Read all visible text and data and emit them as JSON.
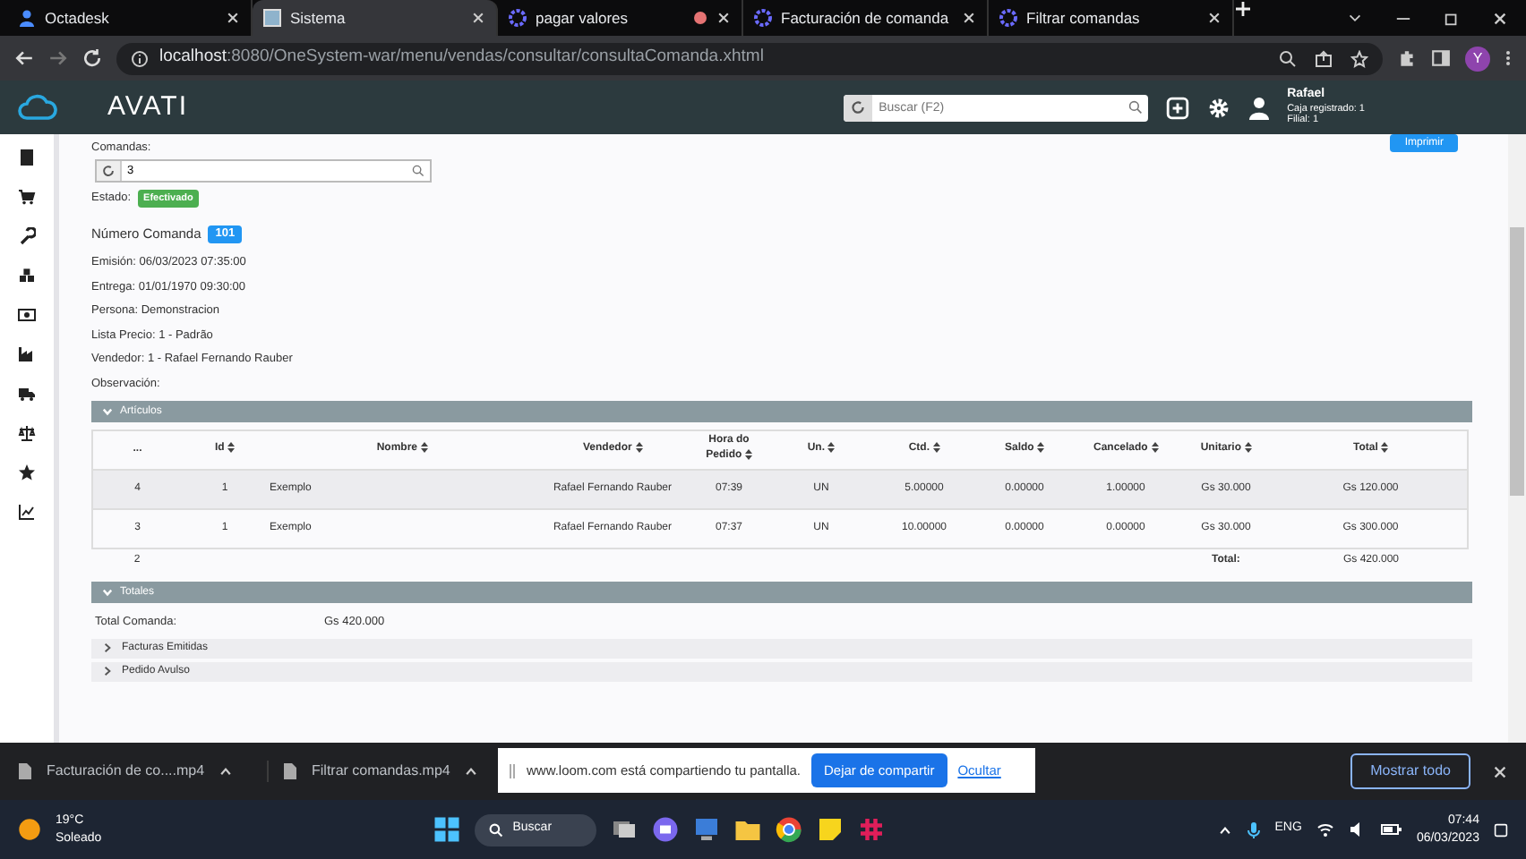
{
  "browser": {
    "tabs": [
      {
        "title": "Octadesk",
        "selected": false
      },
      {
        "title": "Sistema",
        "selected": true
      },
      {
        "title": "pagar valores",
        "selected": false,
        "recording": true
      },
      {
        "title": "Facturación de comanda",
        "selected": false
      },
      {
        "title": "Filtrar comandas",
        "selected": false
      }
    ],
    "url_host": "localhost",
    "url_rest": ":8080/OneSystem-war/menu/vendas/consultar/consultaComanda.xhtml",
    "profile": "Y"
  },
  "app": {
    "brand": "AVATI",
    "search_placeholder": "Buscar (F2)",
    "user": "Rafael",
    "user_lines": [
      "Caja registrado: 1",
      "Filial: 1"
    ],
    "print_button": "Imprimir"
  },
  "form": {
    "comandas_label": "Comandas:",
    "comandas_value": "3",
    "estado_label": "Estado:",
    "estado": "Efectivado",
    "numero_label": "Número Comanda",
    "numero": "101",
    "details": [
      "Emisión: 06/03/2023 07:35:00",
      "Entrega: 01/01/1970 09:30:00",
      "Persona: Demonstracion",
      "Lista Precio: 1 - Padrão",
      "Vendedor: 1 - Rafael Fernando Rauber",
      "Observación:"
    ]
  },
  "articulos": {
    "title": "Artículos",
    "expanded": true,
    "columns": [
      {
        "label": "...",
        "sortable": false
      },
      {
        "label": "Id",
        "sortable": true
      },
      {
        "label": "Nombre",
        "sortable": true
      },
      {
        "label": "Vendedor",
        "sortable": true
      },
      {
        "label": "Hora do Pedido",
        "sortable": true
      },
      {
        "label": "Un.",
        "sortable": true
      },
      {
        "label": "Ctd.",
        "sortable": true
      },
      {
        "label": "Saldo",
        "sortable": true
      },
      {
        "label": "Cancelado",
        "sortable": true
      },
      {
        "label": "Unitario",
        "sortable": true
      },
      {
        "label": "Total",
        "sortable": true
      }
    ],
    "rows": [
      {
        "selected": true,
        "cells": [
          "4",
          "1",
          "Exemplo",
          "Rafael Fernando Rauber",
          "07:39",
          "UN",
          "5.00000",
          "0.00000",
          "1.00000",
          "Gs 30.000",
          "Gs 120.000"
        ]
      },
      {
        "selected": false,
        "cells": [
          "3",
          "1",
          "Exemplo",
          "Rafael Fernando Rauber",
          "07:37",
          "UN",
          "10.00000",
          "0.00000",
          "0.00000",
          "Gs 30.000",
          "Gs 300.000"
        ]
      }
    ],
    "footer": {
      "count": "2",
      "total_label": "Total:",
      "total": "Gs 420.000"
    }
  },
  "totales": {
    "title": "Totales",
    "expanded": true,
    "label": "Total Comanda:",
    "value": "Gs 420.000"
  },
  "panels": [
    {
      "title": "Facturas Emitidas",
      "expanded": false
    },
    {
      "title": "Pedido Avulso",
      "expanded": false
    }
  ],
  "downloads": {
    "files": [
      "Facturación de co....mp4",
      "Filtrar comandas.mp4"
    ],
    "show_all": "Mostrar todo"
  },
  "share_banner": {
    "text": "www.loom.com está compartiendo tu pantalla.",
    "stop": "Dejar de compartir",
    "hide": "Ocultar"
  },
  "taskbar": {
    "temperature": "19°C",
    "weather": "Soleado",
    "search": "Buscar",
    "language": "ENG",
    "time": "07:44",
    "date": "06/03/2023"
  }
}
